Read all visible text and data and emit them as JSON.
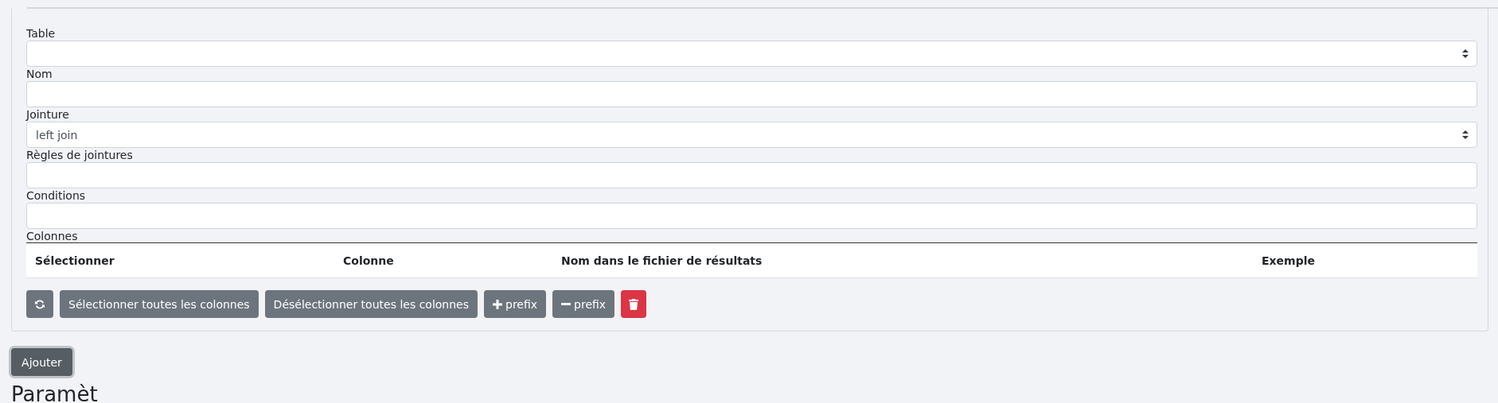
{
  "form": {
    "fields": [
      {
        "label": "Table",
        "kind": "select"
      },
      {
        "label": "Nom",
        "kind": "text"
      },
      {
        "label": "Jointure",
        "kind": "select",
        "value": "left join"
      },
      {
        "label": "Règles de jointures",
        "kind": "text"
      },
      {
        "label": "Conditions",
        "kind": "text"
      }
    ],
    "columns_label": "Colonnes",
    "table": {
      "columns": [
        "Sélectionner",
        "Colonne",
        "Nom dans le fichier de résultats",
        "Exemple"
      ]
    },
    "buttons": [
      {
        "kind": "refresh"
      },
      {
        "kind": "text",
        "label": "Sélectionner toutes les colonnes"
      },
      {
        "kind": "text",
        "label": "Désélectionner toutes les colonnes"
      },
      {
        "kind": "plus",
        "label": "prefix"
      },
      {
        "kind": "minus",
        "label": "prefix"
      },
      {
        "kind": "delete"
      }
    ]
  },
  "add_button": "Ajouter",
  "next_heading": "Paramèt"
}
